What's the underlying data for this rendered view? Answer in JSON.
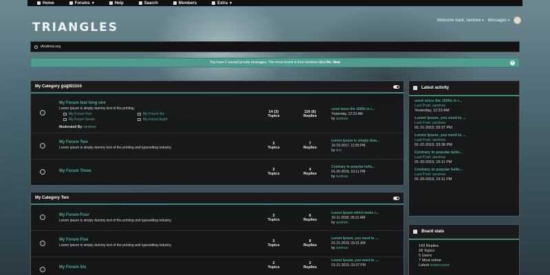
{
  "nav": {
    "items": [
      {
        "label": "Home",
        "icon": "home-icon",
        "caret": ""
      },
      {
        "label": "Forums",
        "icon": "forums-icon",
        "caret": "▾"
      },
      {
        "label": "Help",
        "icon": "help-icon",
        "caret": ""
      },
      {
        "label": "Search",
        "icon": "search-icon",
        "caret": ""
      },
      {
        "label": "Members",
        "icon": "members-icon",
        "caret": ""
      },
      {
        "label": "Extra",
        "icon": "extra-icon",
        "caret": "▾"
      }
    ]
  },
  "brand": {
    "logo": "TRIANGLES"
  },
  "user": {
    "welcome": "Welcome back, iandrew",
    "messages": "Messages"
  },
  "breadcrumb": {
    "site": "iAndrew.org"
  },
  "notice": {
    "text_pre": "You have 2 unread private messages. The most recent is from iandrew titled",
    "title": "Re: New"
  },
  "categories": [
    {
      "name": "My Category ġúģllžźžćö",
      "forums": [
        {
          "title": "My Forum test long one",
          "description": "Lorem Ipsum is simply dummy text of the printing.",
          "subforums": [
            "My Forum Five",
            "My Forum Six",
            "My Forum Seven",
            "My Forum Eight"
          ],
          "moderated_by_label": "Moderated By:",
          "moderator": "iandrew",
          "topics": "14 (3)",
          "replies": "116 (6)",
          "last_title": "used since the 1500s is r...",
          "last_date": "Yesterday, 12:23 AM",
          "last_by_label": "by",
          "last_by": "iandrew"
        },
        {
          "title": "My Forum Two",
          "description": "Lorem Ipsum is simply dummy text of the printing and typesetting industry.",
          "topics": "3",
          "replies": "7",
          "last_title": "Lorem Ipsum is simply dum...",
          "last_date": "10-23-2017, 11:55 PM",
          "last_by_label": "by",
          "last_by": "test"
        },
        {
          "title": "My Forum Three",
          "description": "",
          "topics": "3",
          "replies": "4",
          "last_title": "Contrary to popular belie...",
          "last_date": "01-20-2019, 10:11 PM",
          "last_by_label": "by",
          "last_by": "iandrew"
        }
      ]
    },
    {
      "name": "My Category Two",
      "forums": [
        {
          "title": "My Forum Four",
          "description": "Lorem Ipsum is simply dummy text of the printing and typesetting industry.",
          "topics": "3",
          "replies": "6",
          "last_title": "Lorem Ipsum which looks r...",
          "last_date": "10-11-2018, 05:31 AM",
          "last_by_label": "by",
          "last_by": "iandrew"
        },
        {
          "title": "My Forum Five",
          "description": "Lorem Ipsum is simply dummy text of the printing and typesetting industry.",
          "topics": "3",
          "replies": "8",
          "last_title": "Lorem Ipsum, you need to ...",
          "last_date": "01-21-2019, 03:31 AM",
          "last_by_label": "by",
          "last_by": "iandrew"
        },
        {
          "title": "My Forum Six",
          "description": "",
          "topics": "2",
          "replies": "2",
          "last_title": "Lorem Ipsum, you need to ...",
          "last_date": "01-21-2019, 03:37 PM",
          "last_by_label": "by",
          "last_by": ""
        }
      ]
    }
  ],
  "labels": {
    "topics": "Topics",
    "replies": "Replies"
  },
  "activity": {
    "title": "Latest activity",
    "items": [
      {
        "title": "used since the 1500s is r...",
        "last": "Last Post: iandrew",
        "date": "Yesterday, 12:23 AM"
      },
      {
        "title": "Lorem Ipsum, you need to ...",
        "last": "Last Post: iandrew",
        "date": "01-21-2019, 03:37 PM"
      },
      {
        "title": "Lorem Ipsum, you need to ...",
        "last": "Last Post: iandrew",
        "date": "01-21-2019, 03:36 PM"
      },
      {
        "title": "Contrary to popular belie...",
        "last": "Last Post: iandrew",
        "date": "01-20-2019, 10:11 PM"
      },
      {
        "title": "Contrary to popular belie...",
        "last": "Last Post: iandrew",
        "date": "01-20-2019, 10:11 PM"
      }
    ]
  },
  "board_stats": {
    "title": "Board stats",
    "lines": [
      "143 Replies",
      "28 Topics",
      "5 Users",
      "7 Most online"
    ],
    "latest_label": "Latest",
    "latest_user": "testaccount"
  }
}
